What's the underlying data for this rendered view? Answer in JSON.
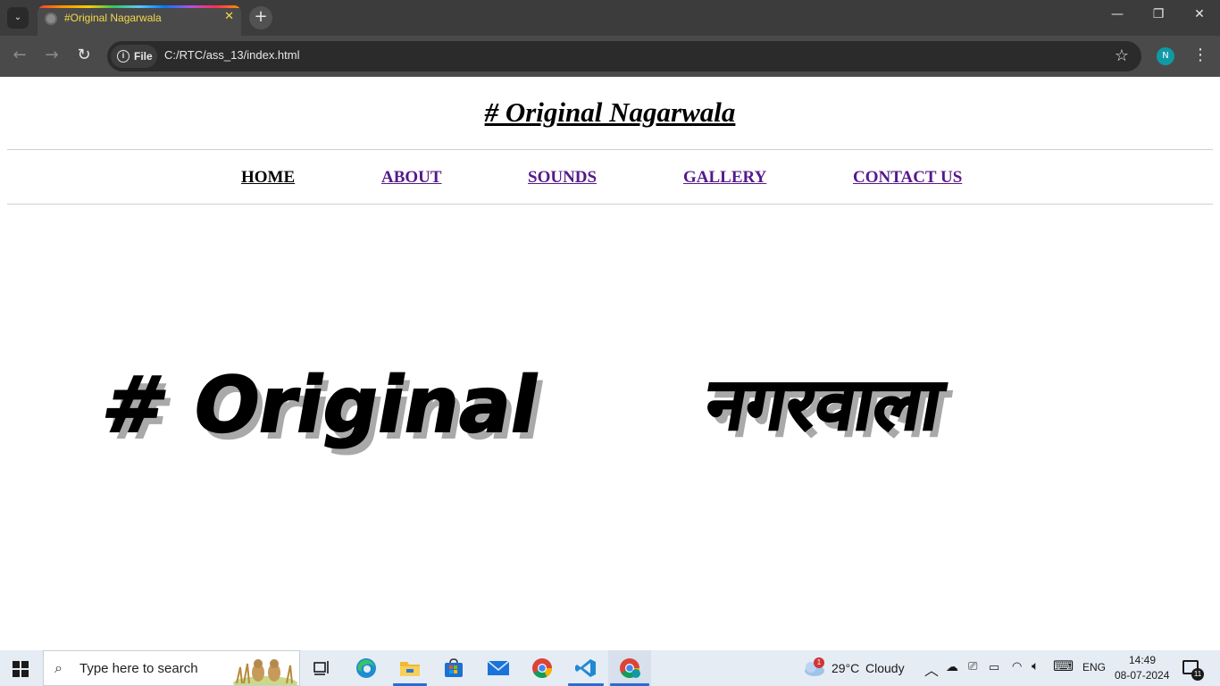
{
  "browser": {
    "tab_title": "#Original Nagarwala",
    "tab_close": "✕",
    "new_tab": "+",
    "url_chip": "File",
    "url": "C:/RTC/ass_13/index.html",
    "profile_initial": "N",
    "window_controls": {
      "minimize": "—",
      "maximize": "❐",
      "close": "✕"
    },
    "nav_glyphs": {
      "back": "←",
      "forward": "→",
      "reload": "↻",
      "star": "☆",
      "menu": "⋮",
      "tab_search": "⌄"
    }
  },
  "page": {
    "title": "# Original Nagarwala",
    "nav": [
      {
        "label": "HOME"
      },
      {
        "label": "ABOUT"
      },
      {
        "label": "SOUNDS"
      },
      {
        "label": "GALLERY"
      },
      {
        "label": "CONTACT US"
      }
    ],
    "hero": {
      "latin": "# Original",
      "devanagari": "नगरवाला"
    },
    "colors": {
      "link_visited": "#551a8b",
      "link_active": "#000000",
      "divider": "#9a9a9a"
    }
  },
  "taskbar": {
    "search_placeholder": "Type here to search",
    "weather": {
      "temp": "29°C",
      "condition": "Cloudy",
      "badge": "1"
    },
    "language": "ENG",
    "time": "14:49",
    "date": "08-07-2024",
    "notification_count": "11",
    "apps": [
      "task-view",
      "edge",
      "file-explorer",
      "microsoft-store",
      "mail",
      "chrome",
      "vscode",
      "chrome-profile"
    ]
  }
}
